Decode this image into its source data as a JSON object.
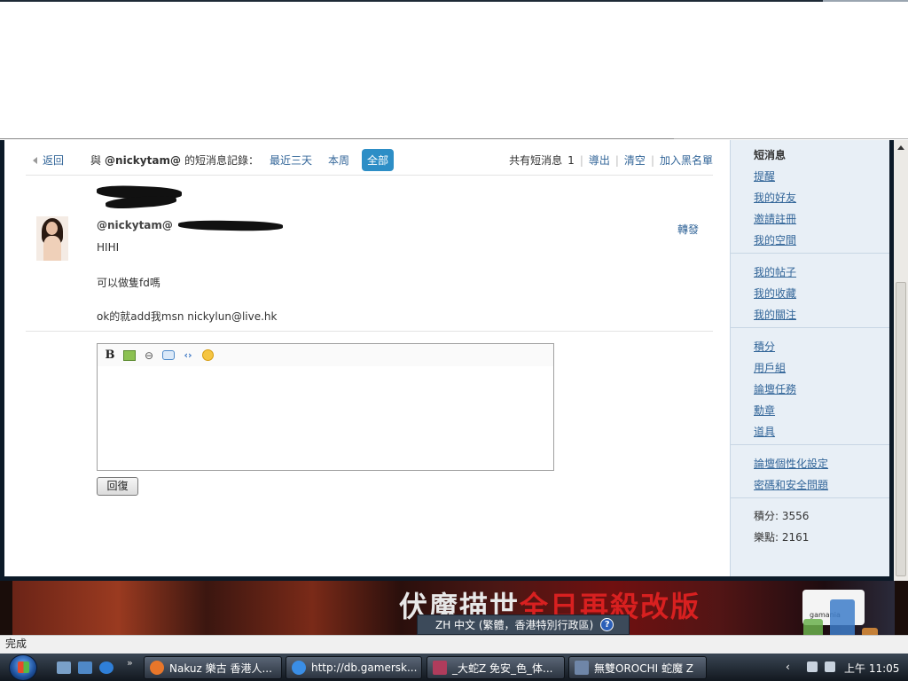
{
  "browser": {
    "status_text": "完成"
  },
  "toolbar": {
    "back_label": "返回",
    "conversation_prefix": "與",
    "conversation_user": "@nickytam@",
    "conversation_suffix": "的短消息記錄：",
    "filter_recent": "最近三天",
    "filter_week": "本周",
    "filter_all": "全部",
    "total_label": "共有短消息",
    "total_count": "1",
    "export_label": "導出",
    "clear_label": "清空",
    "blacklist_label": "加入黑名單"
  },
  "message": {
    "from": "@nickytam@",
    "forward_label": "轉發",
    "lines": [
      "HIHI",
      "可以做隻fd嗎",
      "ok的就add我msn nickylun@live.hk"
    ]
  },
  "editor": {
    "tools": [
      "bold-icon",
      "image-icon",
      "link-icon",
      "quote-icon",
      "code-icon",
      "smiley-icon"
    ],
    "bold_glyph": "B",
    "code_glyph": "‹›",
    "reply_button": "回復"
  },
  "sidebar": {
    "title": "短消息",
    "group1": [
      "提醒",
      "我的好友",
      "邀請註冊",
      "我的空間"
    ],
    "group2": [
      "我的帖子",
      "我的收藏",
      "我的關注"
    ],
    "group3": [
      "積分",
      "用戶組",
      "論壇任務",
      "勳章",
      "道具"
    ],
    "group4": [
      "論壇個性化設定",
      "密碼和安全問題"
    ],
    "stat_points": "積分: 3556",
    "stat_fun": "樂點: 2161"
  },
  "banner": {
    "title_white": "伏魔描世",
    "title_red": "全日再殺改版",
    "logo_text": "gamania"
  },
  "ime": {
    "label": "ZH 中文 (繁體，香港特別行政區)",
    "help": "?"
  },
  "taskbar": {
    "items": [
      "Nakuz 樂古 香港人...",
      "http://db.gamersk...",
      "_大蛇Z 免安_色_体...",
      "無雙OROCHI 蛇魔 Z"
    ],
    "more": "»",
    "chevron": "‹",
    "time": "上午 11:05"
  },
  "colors": {
    "link": "#336699",
    "active_filter": "#2d8ec6",
    "sidebar_bg": "#e8eff6"
  }
}
